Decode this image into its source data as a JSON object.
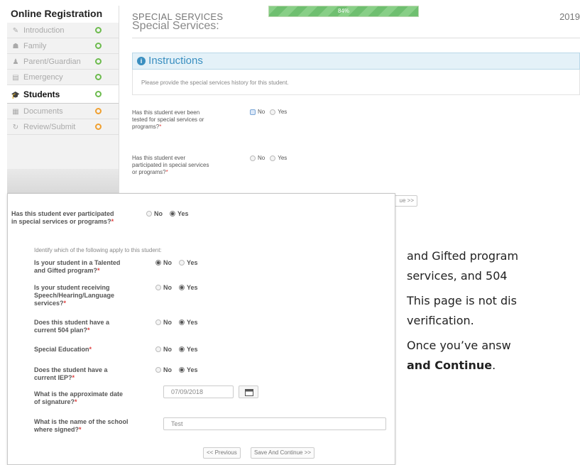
{
  "sidebar": {
    "title": "Online Registration",
    "items": [
      {
        "label": "Introduction",
        "icon": "pencil-icon",
        "status": "complete"
      },
      {
        "label": "Family",
        "icon": "family-icon",
        "status": "complete"
      },
      {
        "label": "Parent/Guardian",
        "icon": "person-icon",
        "status": "complete"
      },
      {
        "label": "Emergency",
        "icon": "card-icon",
        "status": "complete"
      },
      {
        "label": "Students",
        "icon": "graduation-cap-icon",
        "status": "complete",
        "active": true
      },
      {
        "label": "Documents",
        "icon": "document-icon",
        "status": "pending"
      },
      {
        "label": "Review/Submit",
        "icon": "refresh-icon",
        "status": "pending"
      }
    ]
  },
  "header": {
    "section": "SPECIAL SERVICES",
    "year": "2019",
    "progress_label": "84%",
    "progress_value": 84
  },
  "main": {
    "title": "Special Services:",
    "instructions_title": "Instructions",
    "instructions_text": "Please provide the special services history for this student.",
    "questions": [
      {
        "label": "Has this student ever been tested for special services or programs?",
        "no": "No",
        "yes": "Yes"
      },
      {
        "label": "Has this student ever participated in special services or programs?",
        "no": "No",
        "yes": "Yes"
      }
    ],
    "continue_fragment": "ue >>"
  },
  "overlay": {
    "top_question": {
      "label": "Has this student ever participated in special services or programs?",
      "no": "No",
      "yes": "Yes",
      "selected": "Yes"
    },
    "identify_note": "Identify which of the following apply to this student:",
    "questions": [
      {
        "label": "Is your student in a Talented and Gifted program?",
        "no": "No",
        "yes": "Yes",
        "selected": "No"
      },
      {
        "label": "Is your student receiving Speech/Hearing/Language services?",
        "no": "No",
        "yes": "Yes",
        "selected": "Yes"
      },
      {
        "label": "Does this student have a current 504 plan?",
        "no": "No",
        "yes": "Yes",
        "selected": "Yes"
      },
      {
        "label": "Special Education",
        "no": "No",
        "yes": "Yes",
        "selected": "Yes"
      },
      {
        "label": "Does the student have a current IEP?",
        "no": "No",
        "yes": "Yes",
        "selected": "Yes"
      }
    ],
    "date_question": {
      "label": "What is the approximate date of signature?",
      "value": "07/09/2018"
    },
    "school_question": {
      "label": "What is the name of the school where signed?",
      "value": "Test"
    },
    "previous_label": "<< Previous",
    "save_label": "Save And Continue >>"
  },
  "help": {
    "line1": "and Gifted program",
    "line2": "services, and 504",
    "line3": "This page is not dis",
    "line4": "verification.",
    "line5a": "Once you’ve answ",
    "line6": "and Continue",
    "line6_suffix": "."
  },
  "colors": {
    "complete_status": "#6dbb4e",
    "pending_status": "#f0a030",
    "progress": "#6fbf70",
    "instructions_accent": "#3a8fc0",
    "required": "#e04040"
  }
}
